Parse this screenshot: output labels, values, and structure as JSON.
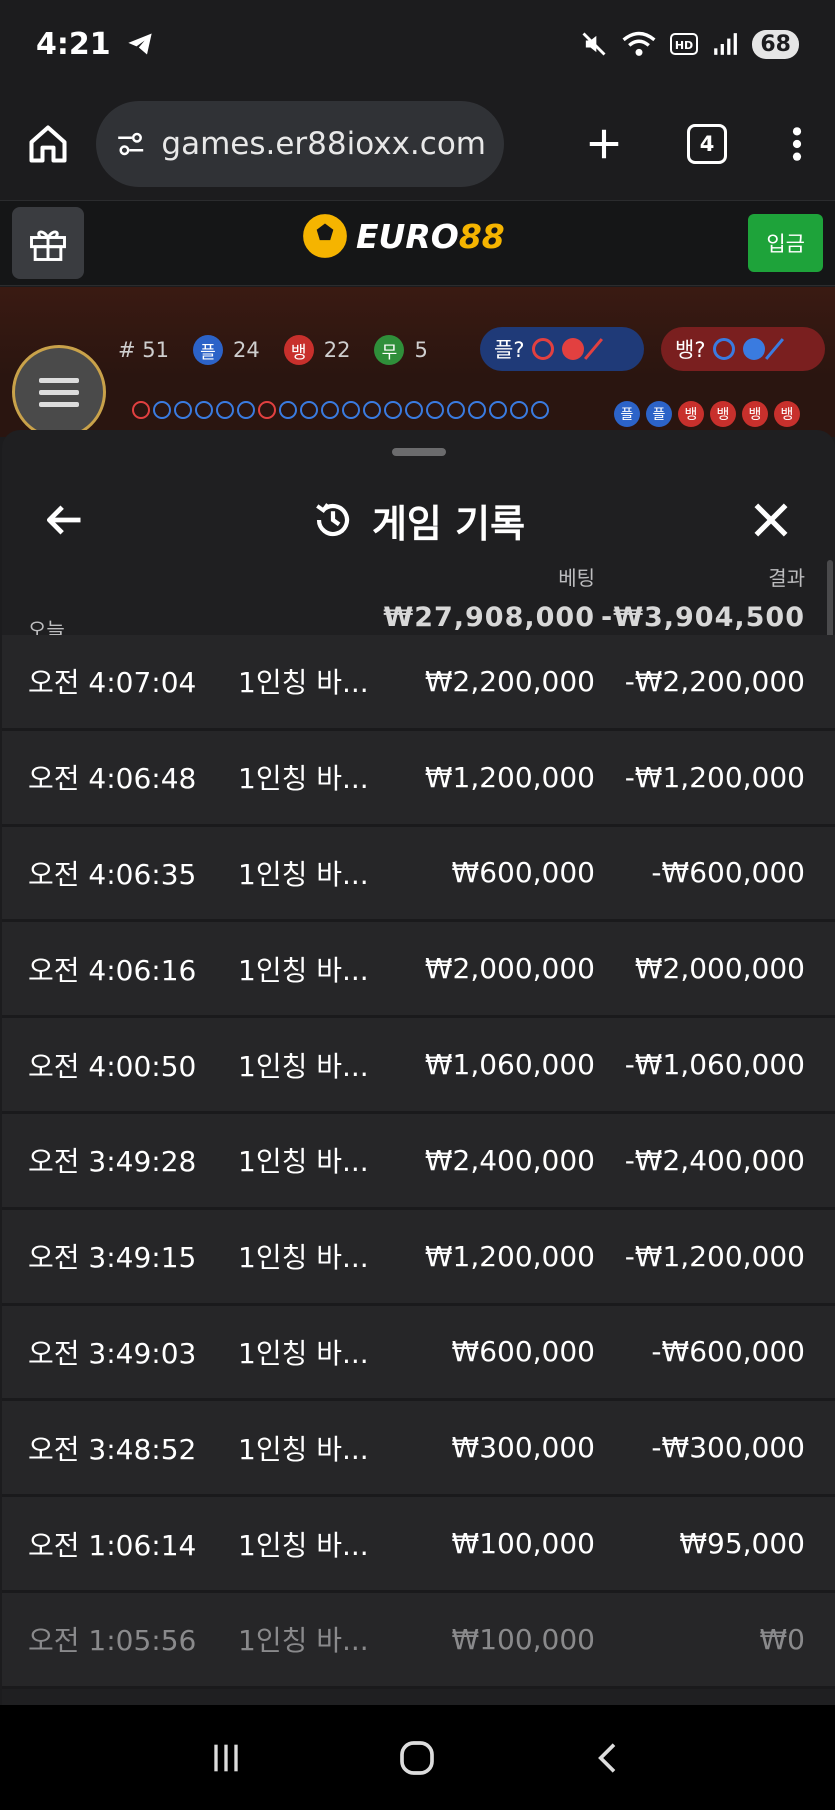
{
  "status_bar": {
    "time": "4:21",
    "battery": "68"
  },
  "browser": {
    "url": "games.er88ioxx.com",
    "tab_count": "4"
  },
  "site": {
    "logo_a": "EURO",
    "logo_b": "88",
    "deposit_label": "입금"
  },
  "game": {
    "round": "# 51",
    "player_badge": "플",
    "player_count": "24",
    "banker_badge": "뱅",
    "banker_count": "22",
    "tie_badge": "무",
    "tie_count": "5",
    "player_predict": "플?",
    "banker_predict": "뱅?",
    "bead_1": "플",
    "bead_2": "플",
    "bead_3": "뱅",
    "bead_4": "뱅",
    "bead_5": "뱅",
    "bead_6": "뱅"
  },
  "history": {
    "title": "게임 기록",
    "bet_col": "베팅",
    "result_col": "결과",
    "today_label": "오늘",
    "total_bet": "₩27,908,000",
    "total_result": "-₩3,904,500",
    "rows": [
      {
        "time": "오전 4:07:04",
        "game": "1인칭 바...",
        "bet": "₩2,200,000",
        "result": "-₩2,200,000"
      },
      {
        "time": "오전 4:06:48",
        "game": "1인칭 바...",
        "bet": "₩1,200,000",
        "result": "-₩1,200,000"
      },
      {
        "time": "오전 4:06:35",
        "game": "1인칭 바...",
        "bet": "₩600,000",
        "result": "-₩600,000"
      },
      {
        "time": "오전 4:06:16",
        "game": "1인칭 바...",
        "bet": "₩2,000,000",
        "result": "₩2,000,000"
      },
      {
        "time": "오전 4:00:50",
        "game": "1인칭 바...",
        "bet": "₩1,060,000",
        "result": "-₩1,060,000"
      },
      {
        "time": "오전 3:49:28",
        "game": "1인칭 바...",
        "bet": "₩2,400,000",
        "result": "-₩2,400,000"
      },
      {
        "time": "오전 3:49:15",
        "game": "1인칭 바...",
        "bet": "₩1,200,000",
        "result": "-₩1,200,000"
      },
      {
        "time": "오전 3:49:03",
        "game": "1인칭 바...",
        "bet": "₩600,000",
        "result": "-₩600,000"
      },
      {
        "time": "오전 3:48:52",
        "game": "1인칭 바...",
        "bet": "₩300,000",
        "result": "-₩300,000"
      },
      {
        "time": "오전 1:06:14",
        "game": "1인칭 바...",
        "bet": "₩100,000",
        "result": "₩95,000"
      },
      {
        "time": "오전 1:05:56",
        "game": "1인칭 바...",
        "bet": "₩100,000",
        "result": "₩0"
      }
    ]
  }
}
